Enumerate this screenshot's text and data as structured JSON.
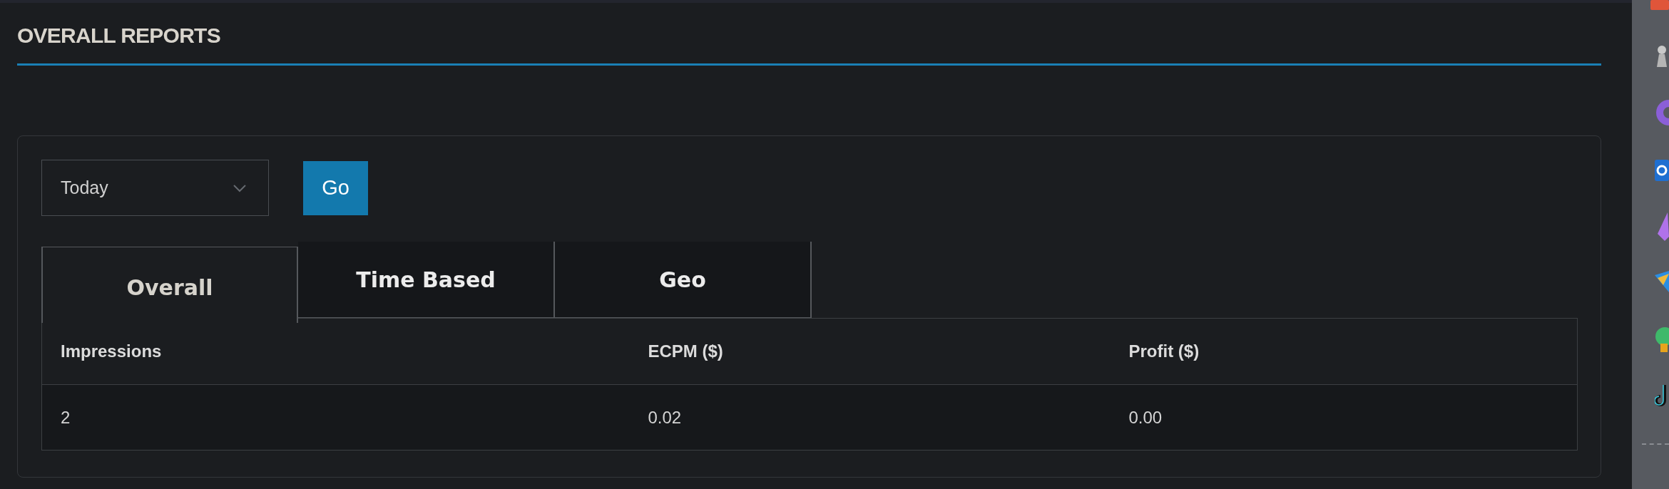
{
  "page_title": "OVERALL REPORTS",
  "filter": {
    "period": "Today",
    "go_button": "Go"
  },
  "tabs": [
    {
      "label": "Overall",
      "selected": true
    },
    {
      "label": "Time Based",
      "selected": false
    },
    {
      "label": "Geo",
      "selected": false
    }
  ],
  "table": {
    "columns": [
      "Impressions",
      "ECPM ($)",
      "Profit ($)"
    ],
    "rows": [
      [
        "2",
        "0.02",
        "0.00"
      ]
    ]
  }
}
